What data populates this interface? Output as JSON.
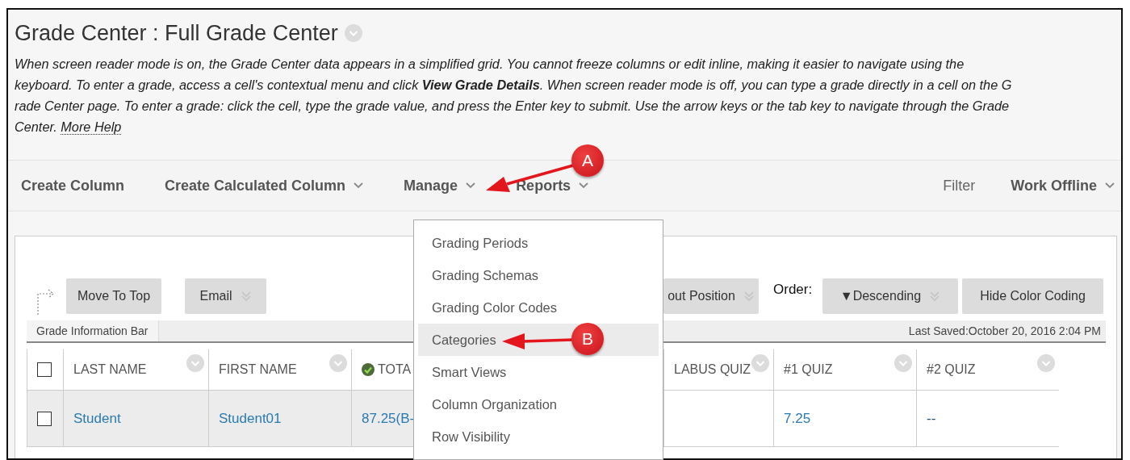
{
  "header": {
    "title": "Grade Center : Full Grade Center",
    "description_lines": [
      "When screen reader mode is on, the Grade Center data appears in a simplified grid. You cannot freeze columns or edit inline, making it easier to navigate using the",
      "keyboard. To enter a grade, access a cell's contextual menu and click **View Grade Details**. When screen reader mode is off, you can type a grade directly in a cell on the G",
      "rade Center page. To enter a grade: click the cell, type the grade value, and press the Enter key to submit. Use the arrow keys or the tab key to navigate through the Grade",
      "Center."
    ],
    "help_link": "More Help"
  },
  "toolbar": {
    "left": [
      {
        "label": "Create Column",
        "kind": "command",
        "dropdown": false
      },
      {
        "label": "Create Calculated Column",
        "kind": "command",
        "dropdown": true
      },
      {
        "label": "Manage",
        "kind": "command",
        "dropdown": true
      },
      {
        "label": "Reports",
        "kind": "command",
        "dropdown": true
      }
    ],
    "right": [
      {
        "label": "Filter",
        "kind": "filter",
        "dropdown": false
      },
      {
        "label": "Work Offline",
        "kind": "command",
        "dropdown": true
      }
    ]
  },
  "grid_controls": [
    {
      "kind": "button",
      "label": "Move To Top",
      "dropdown": false
    },
    {
      "kind": "button",
      "label": "Email",
      "dropdown": true
    },
    {
      "kind": "button",
      "label": "out Position",
      "dropdown": true
    },
    {
      "kind": "label",
      "label": "Order:"
    },
    {
      "kind": "button",
      "label": "▼Descending",
      "dropdown": true
    },
    {
      "kind": "button",
      "label": "Hide Color Coding",
      "dropdown": false
    }
  ],
  "info_bar": {
    "label": "Grade Information Bar",
    "status": "Last Saved:October 20, 2016 2:04 PM"
  },
  "table": {
    "select_all_checked": false,
    "columns": [
      {
        "label": "LAST NAME",
        "frozen": true,
        "menu": true,
        "kind": "text"
      },
      {
        "label": "FIRST NAME",
        "frozen": true,
        "menu": true,
        "kind": "text"
      },
      {
        "label": "TOTA",
        "frozen": true,
        "menu": false,
        "kind": "total"
      },
      {
        "label": "LABUS QUIZ",
        "frozen": false,
        "menu": true,
        "kind": "text"
      },
      {
        "label": "#1 QUIZ",
        "frozen": false,
        "menu": true,
        "kind": "text"
      },
      {
        "label": "#2 QUIZ",
        "frozen": false,
        "menu": true,
        "kind": "text"
      }
    ],
    "rows": [
      {
        "checked": false,
        "cells": [
          "Student",
          "Student01",
          "87.25(B-",
          "",
          "7.25",
          "--"
        ]
      }
    ]
  },
  "manage_menu": {
    "items": [
      {
        "label": "Grading Periods",
        "highlighted": false
      },
      {
        "label": "Grading Schemas",
        "highlighted": false
      },
      {
        "label": "Grading Color Codes",
        "highlighted": false
      },
      {
        "label": "Categories",
        "highlighted": true
      },
      {
        "label": "Smart Views",
        "highlighted": false
      },
      {
        "label": "Column Organization",
        "highlighted": false
      },
      {
        "label": "Row Visibility",
        "highlighted": false
      }
    ]
  },
  "annotations": [
    {
      "label": "A"
    },
    {
      "label": "B"
    }
  ]
}
